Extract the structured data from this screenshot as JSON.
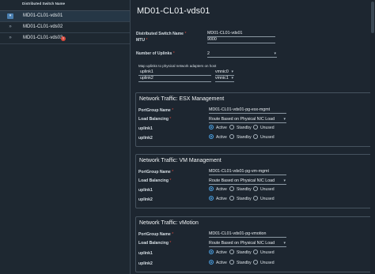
{
  "list": {
    "header": "Distributed Switch Name",
    "items": [
      {
        "name": "MD01-CL01-vds01",
        "control": "▾"
      },
      {
        "name": "MD01-CL01-vds02",
        "control": "»"
      },
      {
        "name": "MD01-CL01-vds03",
        "control": "»",
        "error_badge": "!"
      }
    ]
  },
  "detail": {
    "title": "MD01-CL01-vds01",
    "fields": {
      "switch_name_label": "Distributed Switch Name",
      "switch_name_value": "MD01-CL01-vds01",
      "mtu_label": "MTU",
      "mtu_value": "9000",
      "uplinks_label": "Number of Uplinks",
      "uplinks_value": "2",
      "required_mark": "*"
    },
    "map_caption": "Map uplinks to physical network adapters on host",
    "uplink_map": [
      {
        "uplink": "uplink1",
        "nic": "vmnic0"
      },
      {
        "uplink": "uplink2",
        "nic": "vmnic1"
      }
    ],
    "cards": [
      {
        "title": "Network Traffic: ESX Management",
        "portgroup_label": "PortGroup Name",
        "portgroup_value": "MD01-CL01-vds01-pg-esx-mgmt",
        "lb_label": "Load Balancing",
        "lb_value": "Route Based on Physical NIC Load",
        "uplinks": [
          {
            "label": "uplink1",
            "selected": "Active"
          },
          {
            "label": "uplink2",
            "selected": "Active"
          }
        ]
      },
      {
        "title": "Network Traffic: VM Management",
        "portgroup_label": "PortGroup Name",
        "portgroup_value": "MD01-CL01-vds01-pg-vm-mgmt",
        "lb_label": "Load Balancing",
        "lb_value": "Route Based on Physical NIC Load",
        "uplinks": [
          {
            "label": "uplink1",
            "selected": "Active"
          },
          {
            "label": "uplink2",
            "selected": "Active"
          }
        ]
      },
      {
        "title": "Network Traffic: vMotion",
        "portgroup_label": "PortGroup Name",
        "portgroup_value": "MD01-CL01-vds01-pg-vmotion",
        "lb_label": "Load Balancing",
        "lb_value": "Route Based on Physical NIC Load",
        "uplinks": [
          {
            "label": "uplink1",
            "selected": "Active"
          },
          {
            "label": "uplink2",
            "selected": "Active"
          }
        ]
      }
    ],
    "radio_options": [
      "Active",
      "Standby",
      "Unused"
    ]
  },
  "colors": {
    "background": "#1d2630",
    "accent": "#4a9fe0",
    "error": "#d9483b"
  }
}
